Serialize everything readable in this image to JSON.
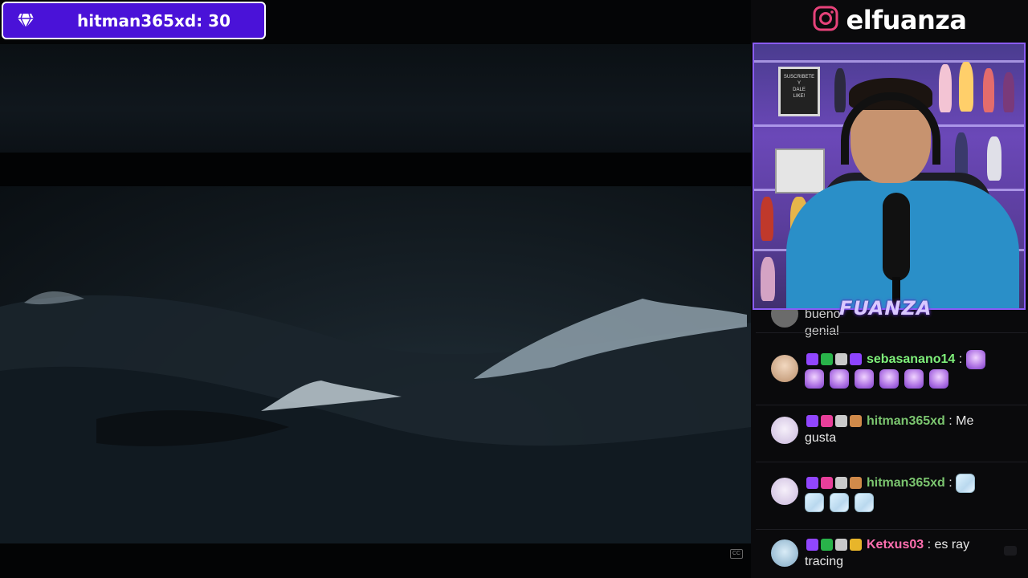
{
  "sub_badge": {
    "icon": "diamond-icon",
    "text": "hitman365xd: 30",
    "bg": "#4a12d8"
  },
  "instagram": {
    "icon": "instagram-icon",
    "handle": "elfuanza"
  },
  "webcam": {
    "logo": "FUANZA",
    "sign_text": "SUSCRIBETE Y DALE LIKE!"
  },
  "chat": {
    "messages": [
      {
        "partial": true,
        "user": "",
        "text": "bueno",
        "text_tail": "genial"
      },
      {
        "user": "sebasanano14",
        "user_color": "#7ff07a",
        "separator": " :",
        "text": "",
        "emotes": [
          "purple",
          "purple",
          "purple",
          "purple",
          "purple",
          "purple",
          "purple"
        ]
      },
      {
        "user": "hitman365xd",
        "user_color": "#7bc56f",
        "separator": " :",
        "text": "Me gusta"
      },
      {
        "user": "hitman365xd",
        "user_color": "#7bc56f",
        "separator": " :",
        "text": "",
        "emotes": [
          "pale",
          "pale",
          "pale",
          "pale"
        ]
      },
      {
        "user": "Ketxus03",
        "user_color": "#ff6fb0",
        "separator": " :",
        "text": "es ray tracing"
      }
    ]
  },
  "colors": {
    "accent": "#8b5cf6",
    "twitch": "#9146ff",
    "chat_bg": "#0a0a0c"
  }
}
